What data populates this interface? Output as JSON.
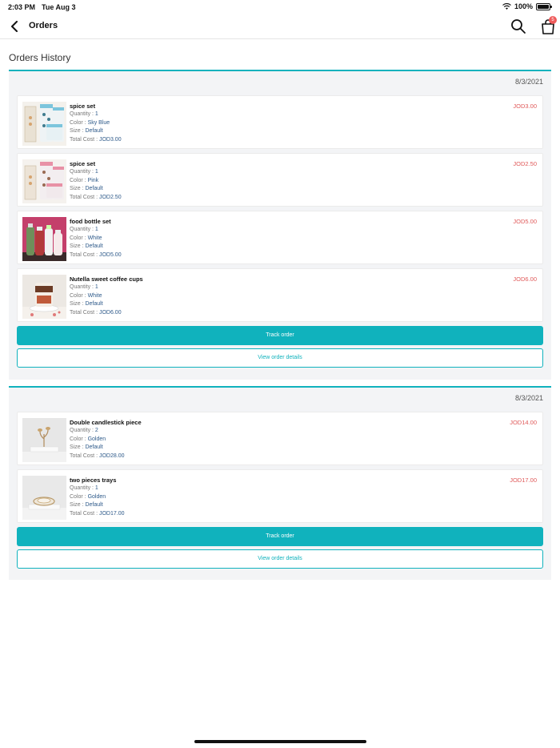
{
  "status_bar": {
    "time": "2:03 PM",
    "date": "Tue Aug 3",
    "battery": "100%"
  },
  "nav": {
    "title": "Orders",
    "cart_count": "5"
  },
  "page_title": "Orders History",
  "labels": {
    "quantity": "Quantity : ",
    "color": "Color : ",
    "size": "Size : ",
    "total_cost": "Total Cost : "
  },
  "orders": [
    {
      "date": "8/3/2021",
      "track_label": "Track order",
      "details_label": "View order details",
      "items": [
        {
          "name": "spice set",
          "quantity": "1",
          "color": "Sky Blue",
          "size": "Default",
          "total": "JOD3.00",
          "price": "JOD3.00"
        },
        {
          "name": "spice set",
          "quantity": "1",
          "color": "Pink",
          "size": "Default",
          "total": "JOD2.50",
          "price": "JOD2.50"
        },
        {
          "name": "food bottle set",
          "quantity": "1",
          "color": "White",
          "size": "Default",
          "total": "JOD5.00",
          "price": "JOD5.00"
        },
        {
          "name": "Nutella sweet coffee cups",
          "quantity": "1",
          "color": "White",
          "size": "Default",
          "total": "JOD6.00",
          "price": "JOD6.00"
        }
      ]
    },
    {
      "date": "8/3/2021",
      "track_label": "Track order",
      "details_label": "View order details",
      "items": [
        {
          "name": "Double candlestick piece",
          "quantity": "2",
          "color": "Golden",
          "size": "Default",
          "total": "JOD28.00",
          "price": "JOD14.00"
        },
        {
          "name": "two pieces trays",
          "quantity": "1",
          "color": "Golden",
          "size": "Default",
          "total": "JOD17.00",
          "price": "JOD17.00"
        }
      ]
    }
  ],
  "colors": {
    "accent": "#10b2bd",
    "price": "#e05a5a",
    "value": "#2e5a8a",
    "badge": "#ef5b5b"
  },
  "icons": {
    "back": "chevron-left-icon",
    "search": "search-icon",
    "cart": "shopping-bag-icon",
    "wifi": "wifi-icon",
    "battery": "battery-icon"
  }
}
